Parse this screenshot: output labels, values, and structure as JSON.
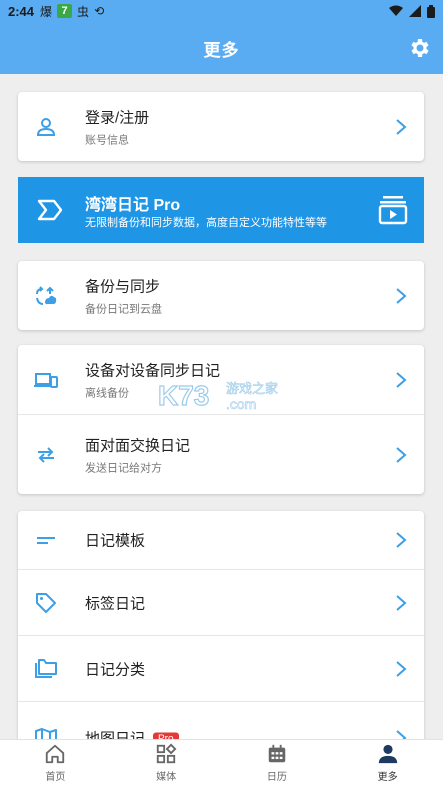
{
  "status": {
    "time": "2:44",
    "icons": [
      "notification-icon",
      "app-7-icon",
      "bug-icon",
      "sync-icon"
    ],
    "app_badge": "7",
    "right_icons": [
      "wifi-icon",
      "signal-icon",
      "battery-icon"
    ]
  },
  "appbar": {
    "title": "更多"
  },
  "login": {
    "title": "登录/注册",
    "subtitle": "账号信息"
  },
  "pro": {
    "title": "湾湾日记 Pro",
    "subtitle": "无限制备份和同步数据，高度自定义功能特性等等"
  },
  "backup": {
    "title": "备份与同步",
    "subtitle": "备份日记到云盘"
  },
  "device_sync": {
    "title": "设备对设备同步日记",
    "subtitle": "离线备份"
  },
  "f2f": {
    "title": "面对面交换日记",
    "subtitle": "发送日记给对方"
  },
  "menu": {
    "template": "日记模板",
    "tags": "标签日记",
    "category": "日记分类",
    "map": "地图日记",
    "map_badge": "Pro"
  },
  "watermark": {
    "brand": "K73",
    "site": "游戏之家",
    "domain": ".com"
  },
  "tabs": [
    {
      "label": "首页",
      "icon": "home-icon"
    },
    {
      "label": "媒体",
      "icon": "media-grid-icon"
    },
    {
      "label": "日历",
      "icon": "calendar-icon"
    },
    {
      "label": "更多",
      "icon": "person-icon"
    }
  ],
  "colors": {
    "primary": "#5aacf2",
    "pro_banner": "#1f95e6",
    "icon_blue": "#3d9fe6",
    "badge_red": "#e53935"
  }
}
